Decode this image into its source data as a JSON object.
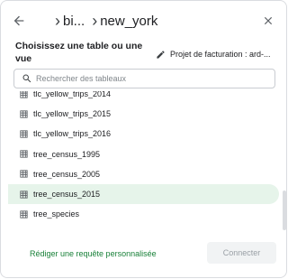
{
  "header": {
    "breadcrumb": [
      {
        "label": "bi..."
      },
      {
        "label": "new_york"
      }
    ]
  },
  "title": "Choisissez une table ou une vue",
  "billing": {
    "label": "Projet de facturation : ard-..."
  },
  "search": {
    "value": "",
    "placeholder": "Rechercher des tableaux"
  },
  "tables": [
    {
      "name": "tlc_yellow_trips_2014",
      "selected": false
    },
    {
      "name": "tlc_yellow_trips_2015",
      "selected": false
    },
    {
      "name": "tlc_yellow_trips_2016",
      "selected": false
    },
    {
      "name": "tree_census_1995",
      "selected": false
    },
    {
      "name": "tree_census_2005",
      "selected": false
    },
    {
      "name": "tree_census_2015",
      "selected": true
    },
    {
      "name": "tree_species",
      "selected": false
    }
  ],
  "footer": {
    "custom_query_label": "Rédiger une requête personnalisée",
    "connect_label": "Connecter"
  },
  "colors": {
    "accent": "#188038",
    "selected_bg": "#e6f4ea"
  }
}
